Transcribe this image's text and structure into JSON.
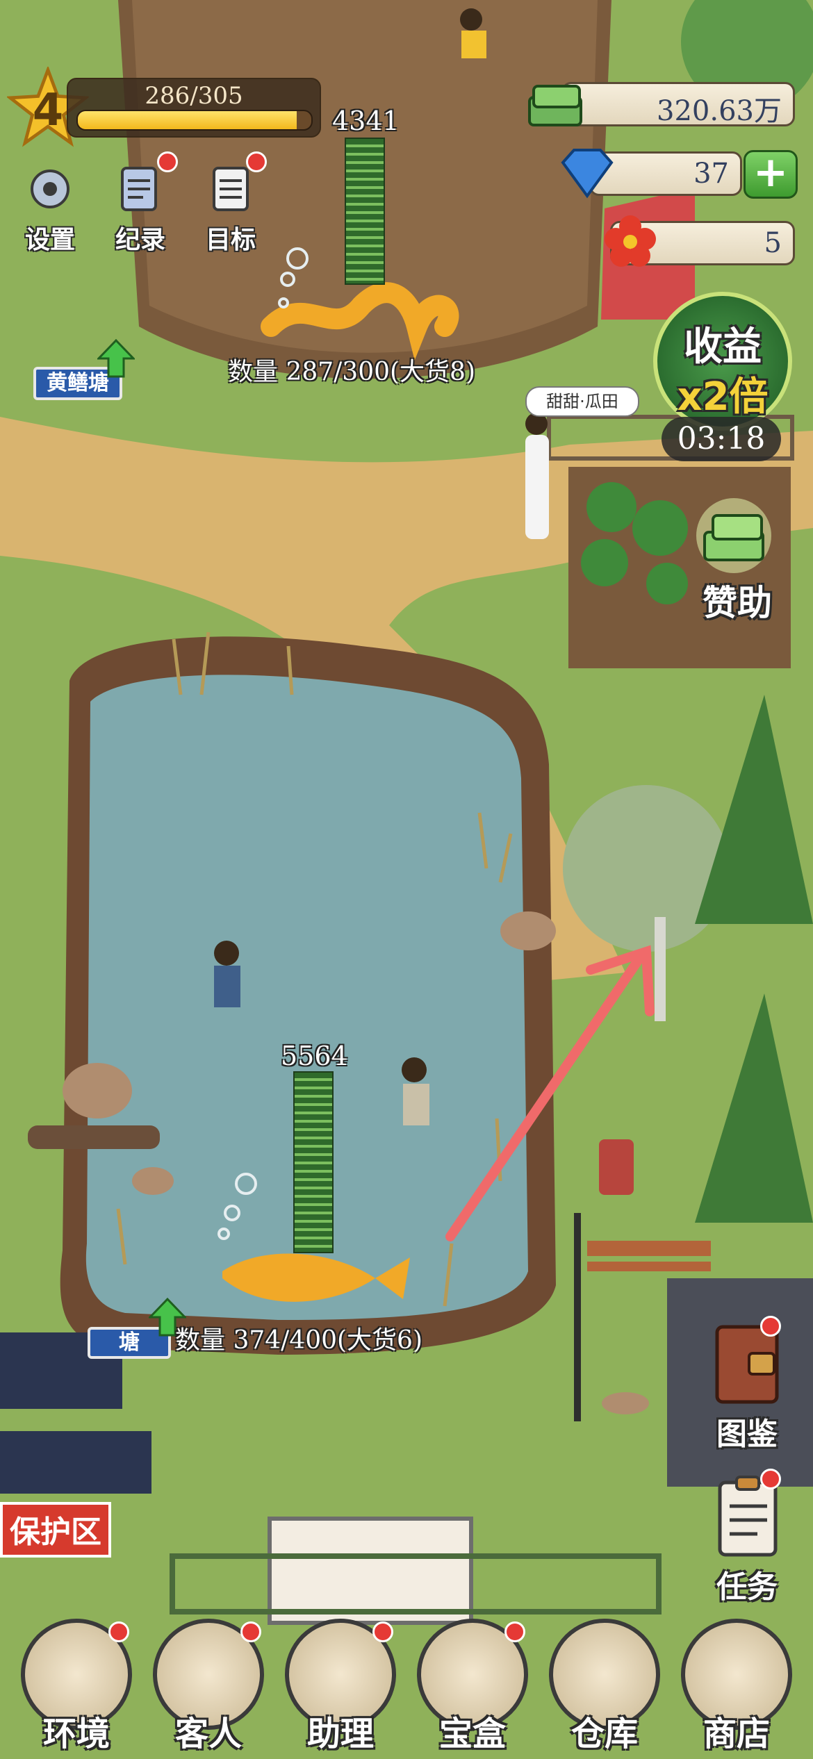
{
  "hud": {
    "level": "4",
    "xp_text": "286/305",
    "xp_progress": 0.938,
    "buttons": [
      {
        "label": "设置",
        "icon": "gear-icon",
        "badge": false
      },
      {
        "label": "纪录",
        "icon": "notepad-icon",
        "badge": true
      },
      {
        "label": "目标",
        "icon": "checklist-icon",
        "badge": true
      }
    ]
  },
  "resources": {
    "cash": "320.63万",
    "gems": "37",
    "flowers": "5"
  },
  "ponds": [
    {
      "sign": "黄鳝塘",
      "stack_count": "4341",
      "quantity": "数量 287/300(大货8)"
    },
    {
      "sign": "塘",
      "stack_count": "5564",
      "quantity": "数量 374/400(大货6)"
    }
  ],
  "boost": {
    "line1": "收益",
    "line2": "x2倍",
    "timer": "03:18"
  },
  "npc_name": "甜甜·瓜田",
  "sponsor_label": "赞助",
  "side_buttons": [
    {
      "label": "图鉴",
      "icon": "book-icon",
      "badge": true
    },
    {
      "label": "任务",
      "icon": "clipboard-icon",
      "badge": true
    }
  ],
  "protect_sign": "保护区",
  "bottom_nav": [
    {
      "label": "环境",
      "icon": "gate-icon",
      "badge": true
    },
    {
      "label": "客人",
      "icon": "guest-icon",
      "badge": true
    },
    {
      "label": "助理",
      "icon": "assistant-icon",
      "badge": true
    },
    {
      "label": "宝盒",
      "icon": "treasure-chest-icon",
      "badge": true
    },
    {
      "label": "仓库",
      "icon": "warehouse-icon",
      "badge": false
    },
    {
      "label": "商店",
      "icon": "shop-icon",
      "badge": false
    }
  ],
  "colors": {
    "grass": "#8fb15a",
    "water": "#7fa9ad",
    "dirt": "#d9b46f",
    "badge": "#e53935",
    "arrow": "#f06a6a"
  }
}
